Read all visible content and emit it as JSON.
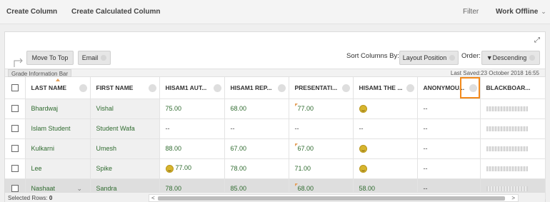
{
  "topbar": {
    "create_column": "Create Column",
    "create_calculated_column": "Create Calculated Column",
    "filter": "Filter",
    "work_offline": "Work Offline"
  },
  "toolbar": {
    "move_to_top": "Move To Top",
    "email": "Email",
    "sort_columns_by_label": "Sort Columns By:",
    "sort_by_value": "Layout Position",
    "order_label": "Order:",
    "order_value": "▼Descending"
  },
  "info_bar": {
    "left": "Grade Information Bar",
    "right": "Last Saved:23 October 2018 16:55"
  },
  "columns": [
    "LAST NAME",
    "FIRST NAME",
    "HISAM1 AUT...",
    "HISAM1 REP...",
    "PRESENTATI...",
    "HISAM1 THE ...",
    "ANONYMOU...",
    "BLACKBOAR..."
  ],
  "rows": [
    {
      "last": "Bhardwaj",
      "first": "Vishal",
      "c1": "75.00",
      "c2": "68.00",
      "c3": "77.00",
      "c4": "",
      "c5": "--"
    },
    {
      "last": "Islam Student",
      "first": "Student Wafa",
      "c1": "--",
      "c2": "--",
      "c3": "--",
      "c4": "--",
      "c5": "--"
    },
    {
      "last": "Kulkarni",
      "first": "Umesh",
      "c1": "88.00",
      "c2": "67.00",
      "c3": "67.00",
      "c4": "",
      "c5": "--"
    },
    {
      "last": "Lee",
      "first": "Spike",
      "c1": "77.00",
      "c2": "78.00",
      "c3": "71.00",
      "c4": "",
      "c5": "--"
    },
    {
      "last": "Nashaat",
      "first": "Sandra",
      "c1": "78.00",
      "c2": "85.00",
      "c3": "68.00",
      "c4": "58.00",
      "c5": "--"
    }
  ],
  "footer": {
    "selected_rows_label": "Selected Rows:",
    "selected_rows_count": "0"
  },
  "colors": {
    "grade_text": "#2f6b2f",
    "highlight": "#f28a1c",
    "needs_grading_flag": "#e5a05a"
  }
}
